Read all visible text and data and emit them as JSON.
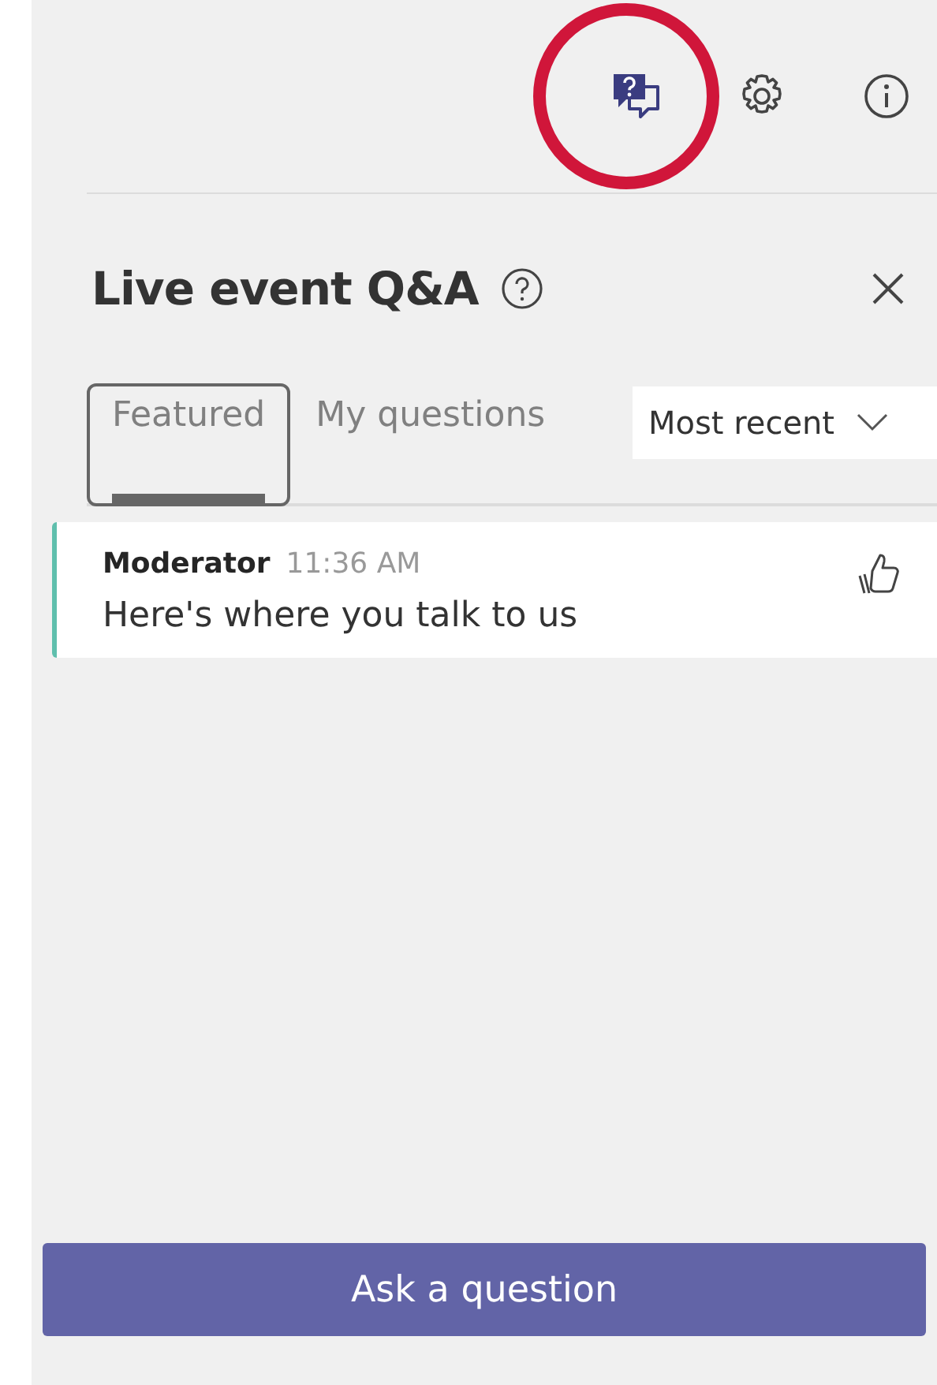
{
  "toolbar": [
    {
      "kind": "qa",
      "selected": true,
      "circled": true
    },
    {
      "kind": "settings",
      "selected": false,
      "circled": false
    },
    {
      "kind": "info",
      "selected": false,
      "circled": false
    }
  ],
  "header": {
    "title": "Live event Q&A"
  },
  "tabs": [
    {
      "label": "Featured",
      "selected": true
    },
    {
      "label": "My questions",
      "selected": false
    }
  ],
  "sort": {
    "value": "Most recent"
  },
  "questions": [
    {
      "author": "Moderator",
      "time": "11:36 AM",
      "text": "Here's where you talk to us"
    }
  ],
  "ask_button": {
    "label": "Ask a question"
  }
}
